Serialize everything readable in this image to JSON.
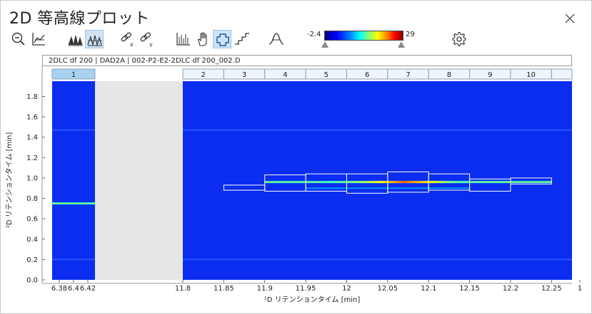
{
  "window": {
    "title": "2D 等高線プロット"
  },
  "toolbar": {
    "colorbar_min": "-2.4",
    "colorbar_max": "29",
    "buttons": [
      "zoom-out",
      "axis",
      "peaks",
      "peaks-outline",
      "link-x",
      "link-y",
      "spectrum",
      "pan",
      "select",
      "steps",
      "peak-shape",
      "settings"
    ],
    "active": [
      "peaks-outline",
      "select"
    ]
  },
  "chart_data": {
    "type": "heatmap",
    "header_label": "2DLC df 200 | DAD2A | 002-P2-E2-2DLC df 200_002.D",
    "xlabel": "¹D リテンションタイム [min]",
    "ylabel": "²D リテンションタイム [min]",
    "ylim": [
      0.0,
      1.95
    ],
    "yticks": [
      "0.0",
      "0.2",
      "0.4",
      "0.6",
      "0.8",
      "1.0",
      "1.2",
      "1.4",
      "1.6",
      "1.8"
    ],
    "x_segments": [
      {
        "range": [
          6.37,
          6.43
        ],
        "ticks": [
          "6.38",
          "6.4",
          "6.42"
        ]
      },
      {
        "range": [
          11.8,
          12.275
        ],
        "ticks": [
          "11.8",
          "11.85",
          "11.9",
          "11.95",
          "12",
          "12.05",
          "12.1",
          "12.15",
          "12.2",
          "12.25",
          "1"
        ]
      }
    ],
    "cuts": [
      {
        "label": "1",
        "x": [
          6.37,
          6.43
        ],
        "selected": true
      },
      {
        "label": "2",
        "x": [
          11.8,
          11.85
        ]
      },
      {
        "label": "3",
        "x": [
          11.85,
          11.9
        ]
      },
      {
        "label": "4",
        "x": [
          11.9,
          11.95
        ]
      },
      {
        "label": "5",
        "x": [
          11.95,
          12.0
        ]
      },
      {
        "label": "6",
        "x": [
          12.0,
          12.05
        ]
      },
      {
        "label": "7",
        "x": [
          12.05,
          12.1
        ]
      },
      {
        "label": "8",
        "x": [
          12.1,
          12.15
        ]
      },
      {
        "label": "9",
        "x": [
          12.15,
          12.2
        ]
      },
      {
        "label": "10",
        "x": [
          12.2,
          12.25
        ]
      }
    ],
    "peak_boxes": [
      {
        "x": [
          11.85,
          11.9
        ],
        "y": [
          0.88,
          0.93
        ]
      },
      {
        "x": [
          11.9,
          11.95
        ],
        "y": [
          0.87,
          1.03
        ]
      },
      {
        "x": [
          11.95,
          12.0
        ],
        "y": [
          0.87,
          1.04
        ]
      },
      {
        "x": [
          12.0,
          12.05
        ],
        "y": [
          0.85,
          1.04
        ]
      },
      {
        "x": [
          12.05,
          12.1
        ],
        "y": [
          0.86,
          1.06
        ]
      },
      {
        "x": [
          12.1,
          12.15
        ],
        "y": [
          0.88,
          1.04
        ]
      },
      {
        "x": [
          12.15,
          12.2
        ],
        "y": [
          0.87,
          0.99
        ]
      },
      {
        "x": [
          12.2,
          12.25
        ],
        "y": [
          0.94,
          1.0
        ]
      }
    ],
    "bands": [
      {
        "y": 1.47,
        "segment": "all",
        "intensity": "low"
      },
      {
        "y": 0.2,
        "segment": "all",
        "intensity": "low"
      },
      {
        "y": 0.75,
        "segment": 0,
        "intensity": "high"
      },
      {
        "y": 0.96,
        "segment": 1,
        "x": [
          11.9,
          12.25
        ],
        "intensity": "high"
      },
      {
        "y": 0.9,
        "segment": 1,
        "x": [
          11.95,
          12.15
        ],
        "intensity": "medium"
      }
    ],
    "colorbar": {
      "min": -2.4,
      "max": 29
    }
  }
}
